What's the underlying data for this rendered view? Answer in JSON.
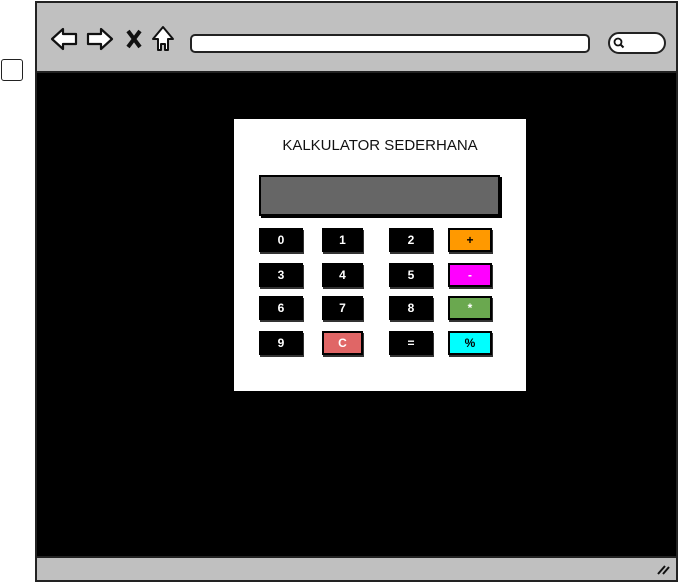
{
  "calculator": {
    "title": "KALKULATOR SEDERHANA",
    "display": "",
    "buttons": [
      {
        "label": "0"
      },
      {
        "label": "1"
      },
      {
        "label": "2"
      },
      {
        "label": "+",
        "color": "#ff9900",
        "text_color": "#000"
      },
      {
        "label": "3"
      },
      {
        "label": "4"
      },
      {
        "label": "5"
      },
      {
        "label": "-",
        "color": "#ff00ff",
        "text_color": "#fff"
      },
      {
        "label": "6"
      },
      {
        "label": "7"
      },
      {
        "label": "8"
      },
      {
        "label": "*",
        "color": "#6aa84f",
        "text_color": "#fff"
      },
      {
        "label": "9"
      },
      {
        "label": "C",
        "color": "#e06666",
        "text_color": "#fff"
      },
      {
        "label": "="
      },
      {
        "label": "%",
        "color": "#00ffff",
        "text_color": "#000"
      }
    ]
  }
}
